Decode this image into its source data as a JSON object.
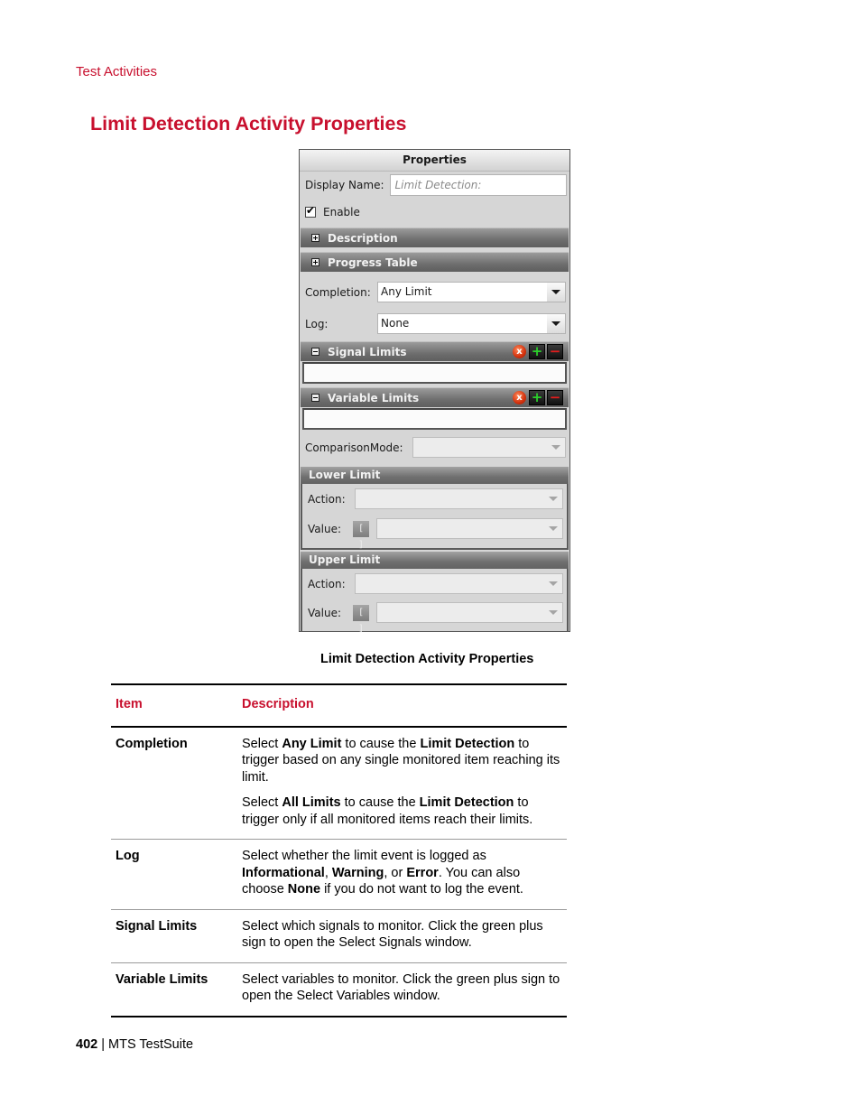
{
  "running_head": "Test Activities",
  "section_title": "Limit Detection Activity Properties",
  "panel": {
    "header": "Properties",
    "display_name_label": "Display Name:",
    "display_name_placeholder": "Limit Detection:",
    "enable_label": "Enable",
    "enable_checked": true,
    "description_label": "Description",
    "progress_table_label": "Progress Table",
    "completion_label": "Completion:",
    "completion_value": "Any Limit",
    "log_label": "Log:",
    "log_value": "None",
    "signal_limits_label": "Signal Limits",
    "variable_limits_label": "Variable Limits",
    "delete_glyph": "x",
    "add_glyph": "+",
    "remove_glyph": "−",
    "comparison_mode_label": "ComparisonMode:",
    "comparison_mode_value": "",
    "lower_limit": {
      "title": "Lower Limit",
      "action_label": "Action:",
      "action_value": "",
      "value_label": "Value:",
      "value_value": "",
      "variable_icon_glyph": "[ ]"
    },
    "upper_limit": {
      "title": "Upper Limit",
      "action_label": "Action:",
      "action_value": "",
      "value_label": "Value:",
      "value_value": "",
      "variable_icon_glyph": "[ ]"
    }
  },
  "caption": "Limit Detection Activity Properties",
  "table": {
    "headers": {
      "item": "Item",
      "description": "Description"
    },
    "rows": [
      {
        "item": "Completion",
        "paragraphs": [
          [
            {
              "t": "Select "
            },
            {
              "t": "Any Limit",
              "b": true
            },
            {
              "t": " to cause the "
            },
            {
              "t": "Limit Detection",
              "b": true
            },
            {
              "t": " to trigger based on any single monitored item reaching its limit."
            }
          ],
          [
            {
              "t": "Select "
            },
            {
              "t": "All Limits",
              "b": true
            },
            {
              "t": " to cause the "
            },
            {
              "t": "Limit Detection",
              "b": true
            },
            {
              "t": " to trigger only if all monitored items reach their limits."
            }
          ]
        ]
      },
      {
        "item": "Log",
        "paragraphs": [
          [
            {
              "t": "Select whether the limit event is logged as "
            },
            {
              "t": "Informational",
              "b": true
            },
            {
              "t": ", "
            },
            {
              "t": "Warning",
              "b": true
            },
            {
              "t": ", or "
            },
            {
              "t": "Error",
              "b": true
            },
            {
              "t": ". You can also choose "
            },
            {
              "t": "None",
              "b": true
            },
            {
              "t": " if you do not want to log the event."
            }
          ]
        ]
      },
      {
        "item": "Signal Limits",
        "paragraphs": [
          [
            {
              "t": "Select which signals to monitor. Click the green plus sign to open the Select Signals window."
            }
          ]
        ]
      },
      {
        "item": "Variable Limits",
        "paragraphs": [
          [
            {
              "t": "Select variables to monitor. Click the green plus sign to open the Select Variables window."
            }
          ]
        ]
      }
    ]
  },
  "footer": {
    "page_number": "402",
    "separator": " | ",
    "product": "MTS TestSuite"
  }
}
